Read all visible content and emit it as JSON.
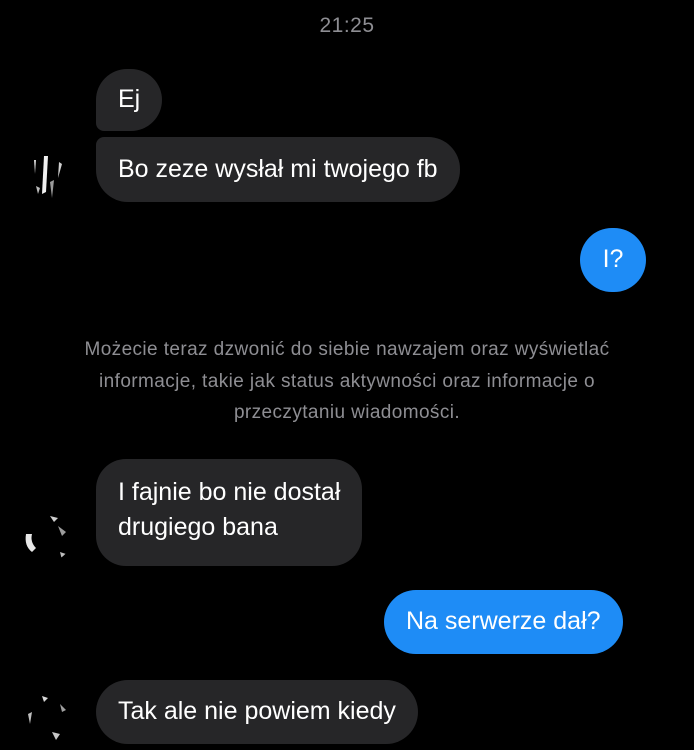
{
  "header": {
    "time": "21:25"
  },
  "messages": {
    "m1": "Ej",
    "m2": "Bo zeze wysłał mi twojego fb",
    "m3": "I?",
    "m4_line1": "I fajnie bo nie dostał",
    "m4_line2": "drugiego bana",
    "m5": "Na serwerze dał?",
    "m6": "Tak ale nie powiem kiedy"
  },
  "notice": {
    "line1": "Możecie teraz dzwonić do siebie nawzajem oraz wyświetlać",
    "line2": "informacje, takie jak status aktywności oraz informacje o",
    "line3": "przeczytaniu wiadomości."
  },
  "colors": {
    "background": "#000000",
    "incoming_bubble": "#262628",
    "outgoing_bubble": "#1e8cf6",
    "muted_text": "#8e8e93"
  }
}
